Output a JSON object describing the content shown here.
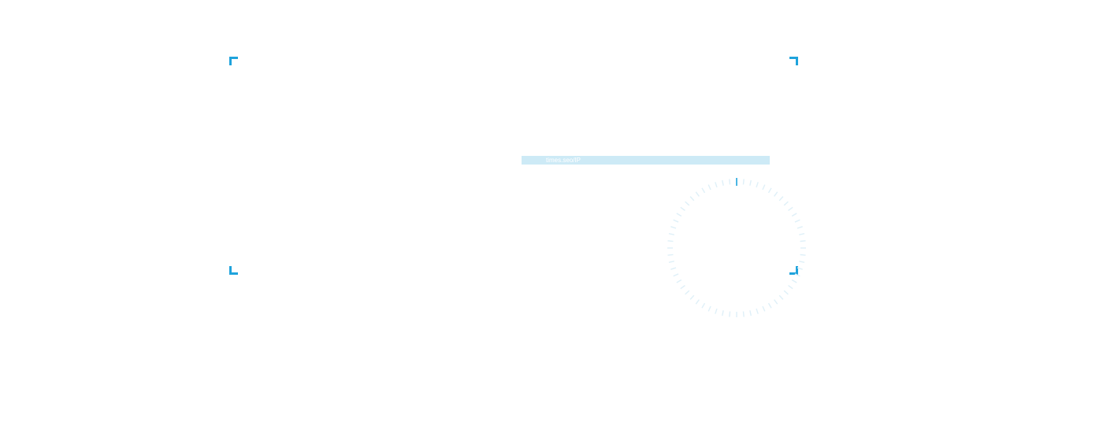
{
  "status": {
    "text": "times.seo/IP"
  },
  "dial": {
    "ticks": 60,
    "progress": 0.0
  },
  "colors": {
    "accent": "#1fa3dc",
    "dial_track": "#dff0f8",
    "status_bar": "#cdeaf6"
  }
}
